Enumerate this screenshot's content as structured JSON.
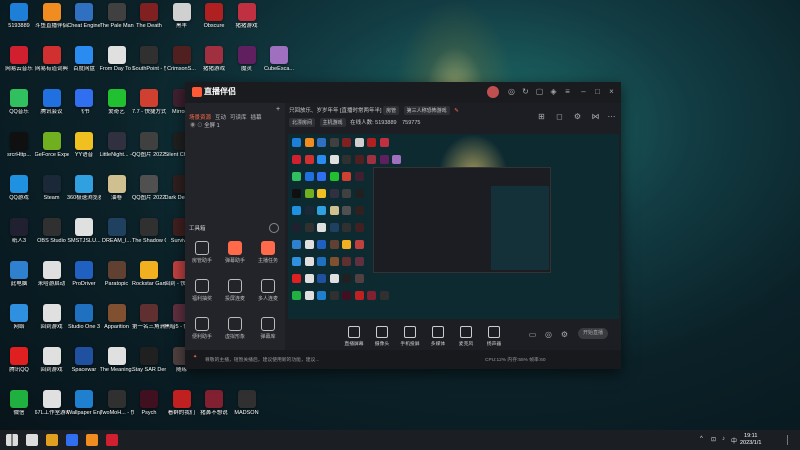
{
  "desktop": {
    "icons": [
      {
        "label": "5193889",
        "color": "#1e7fd8",
        "row": 0,
        "col": 0
      },
      {
        "label": "斗鱼直播伴侣",
        "color": "#f08c20",
        "row": 0,
        "col": 1
      },
      {
        "label": "Cheat Engine",
        "color": "#3070c0",
        "row": 0,
        "col": 2
      },
      {
        "label": "The Pale Man - 快...",
        "color": "#404040",
        "row": 0,
        "col": 3
      },
      {
        "label": "The Death",
        "color": "#802020",
        "row": 0,
        "col": 4
      },
      {
        "label": "黑羊",
        "color": "#d0d0d0",
        "row": 0,
        "col": 5
      },
      {
        "label": "Obscure",
        "color": "#b02020",
        "row": 0,
        "col": 6
      },
      {
        "label": "猪猪游戏",
        "color": "#c03040",
        "row": 0,
        "col": 7
      },
      {
        "label": "网易云音乐",
        "color": "#d02030",
        "row": 1,
        "col": 0
      },
      {
        "label": "网易有道词典",
        "color": "#d03030",
        "row": 1,
        "col": 1
      },
      {
        "label": "百度网盘",
        "color": "#2a8cf0",
        "row": 1,
        "col": 2
      },
      {
        "label": "From Day To Day",
        "color": "#e0e0e0",
        "row": 1,
        "col": 3
      },
      {
        "label": "SouthPoint - 快捷方式",
        "color": "#303030",
        "row": 1,
        "col": 4
      },
      {
        "label": "CrimsonS...",
        "color": "#502020",
        "row": 1,
        "col": 5
      },
      {
        "label": "猪猪游戏",
        "color": "#a03040",
        "row": 1,
        "col": 6
      },
      {
        "label": "魔灵",
        "color": "#602060",
        "row": 1,
        "col": 7
      },
      {
        "label": "CubeEsca...",
        "color": "#a070c0",
        "row": 1,
        "col": 8
      },
      {
        "label": "QQ音乐",
        "color": "#30c060",
        "row": 2,
        "col": 0
      },
      {
        "label": "腾讯会议",
        "color": "#2070e0",
        "row": 2,
        "col": 1
      },
      {
        "label": "飞书",
        "color": "#3070f0",
        "row": 2,
        "col": 2
      },
      {
        "label": "爱奇艺",
        "color": "#20c030",
        "row": 2,
        "col": 3
      },
      {
        "label": "7.7 - 快捷方式",
        "color": "#d04030",
        "row": 2,
        "col": 4
      },
      {
        "label": "Mirror 2",
        "color": "#402030",
        "row": 2,
        "col": 5
      },
      {
        "label": "srcrHttp...",
        "color": "#101010",
        "row": 3,
        "col": 0
      },
      {
        "label": "GeForce Experience",
        "color": "#70b020",
        "row": 3,
        "col": 1
      },
      {
        "label": "YY语音",
        "color": "#f0c020",
        "row": 3,
        "col": 2
      },
      {
        "label": "LittleNight... - 快捷方式",
        "color": "#303040",
        "row": 3,
        "col": 3
      },
      {
        "label": "QQ图片 2022123...",
        "color": "#404040",
        "row": 3,
        "col": 4
      },
      {
        "label": "Silent Channel",
        "color": "#202020",
        "row": 3,
        "col": 5
      },
      {
        "label": "QQ游戏",
        "color": "#2090e0",
        "row": 4,
        "col": 0
      },
      {
        "label": "Steam",
        "color": "#1b2838",
        "row": 4,
        "col": 1
      },
      {
        "label": "360极速浏览器",
        "color": "#30a0e0",
        "row": 4,
        "col": 2
      },
      {
        "label": "油卷",
        "color": "#d0c090",
        "row": 4,
        "col": 3
      },
      {
        "label": "QQ图片 2022123...",
        "color": "#505050",
        "row": 4,
        "col": 4
      },
      {
        "label": "Dark Deception",
        "color": "#302020",
        "row": 4,
        "col": 5
      },
      {
        "label": "纸人3",
        "color": "#202030",
        "row": 5,
        "col": 0
      },
      {
        "label": "OBS Studio",
        "color": "#303030",
        "row": 5,
        "col": 1
      },
      {
        "label": "SMSTJSLU...",
        "color": "#e0e0e0",
        "row": 5,
        "col": 2
      },
      {
        "label": "DREAM_I...",
        "color": "#204060",
        "row": 5,
        "col": 3
      },
      {
        "label": "The Shadow Over Rout...",
        "color": "#303030",
        "row": 5,
        "col": 4
      },
      {
        "label": "Survive?",
        "color": "#402020",
        "row": 5,
        "col": 5
      },
      {
        "label": "此电脑",
        "color": "#3080d0",
        "row": 6,
        "col": 0
      },
      {
        "label": "米哈游启动",
        "color": "#e0e0e0",
        "row": 6,
        "col": 1
      },
      {
        "label": "ProDriver",
        "color": "#2060c0",
        "row": 6,
        "col": 2
      },
      {
        "label": "Paratopic",
        "color": "#604030",
        "row": 6,
        "col": 3
      },
      {
        "label": "Rockstar Games...",
        "color": "#f0b020",
        "row": 6,
        "col": 4
      },
      {
        "label": "回到 - 快捷方式",
        "color": "#c04040",
        "row": 6,
        "col": 5
      },
      {
        "label": "网络",
        "color": "#3090e0",
        "row": 7,
        "col": 0
      },
      {
        "label": "回到游戏",
        "color": "#e0e0e0",
        "row": 7,
        "col": 1
      },
      {
        "label": "Studio One 3",
        "color": "#2070c0",
        "row": 7,
        "col": 2
      },
      {
        "label": "Apparition",
        "color": "#805030",
        "row": 7,
        "col": 3
      },
      {
        "label": "第一名三角洲行动",
        "color": "#603030",
        "row": 7,
        "col": 4
      },
      {
        "label": "黑暗5 - 快捷方式",
        "color": "#603040",
        "row": 7,
        "col": 5
      },
      {
        "label": "腾讯QQ",
        "color": "#e02020",
        "row": 8,
        "col": 0
      },
      {
        "label": "回到游戏",
        "color": "#e0e0e0",
        "row": 8,
        "col": 1
      },
      {
        "label": "Spacewar",
        "color": "#2050a0",
        "row": 8,
        "col": 2
      },
      {
        "label": "The Meaning...",
        "color": "#e0e0e0",
        "row": 8,
        "col": 3
      },
      {
        "label": "Stay SAR Demo",
        "color": "#202020",
        "row": 8,
        "col": 4
      },
      {
        "label": "随缘",
        "color": "#504040",
        "row": 8,
        "col": 5
      },
      {
        "label": "微信",
        "color": "#20b040",
        "row": 9,
        "col": 0
      },
      {
        "label": "67L工作室游戏",
        "color": "#e0e0e0",
        "row": 9,
        "col": 1
      },
      {
        "label": "Wallpaper Engine...",
        "color": "#2080d0",
        "row": 9,
        "col": 2
      },
      {
        "label": "TwoMoH... - 快捷方式",
        "color": "#303030",
        "row": 9,
        "col": 3
      },
      {
        "label": "Psych",
        "color": "#401020",
        "row": 9,
        "col": 4
      },
      {
        "label": "看群的我们",
        "color": "#c02020",
        "row": 9,
        "col": 5
      },
      {
        "label": "猪鼻不想说",
        "color": "#802030",
        "row": 9,
        "col": 6
      },
      {
        "label": "MADSON",
        "color": "#303030",
        "row": 9,
        "col": 7
      }
    ]
  },
  "app": {
    "title": "直播伴侣",
    "left_tabs": [
      "场景资源",
      "互动",
      "可读库",
      "插幕"
    ],
    "scene_label": "全屏 1",
    "tools_title": "工具箱",
    "tools": [
      {
        "label": "房管助手",
        "hot": false
      },
      {
        "label": "弹幕助手",
        "hot": true
      },
      {
        "label": "主播任务",
        "hot": true
      },
      {
        "label": "福利抽奖",
        "hot": false
      },
      {
        "label": "投屏连麦",
        "hot": false
      },
      {
        "label": "多人连麦",
        "hot": false
      },
      {
        "label": "便利助手",
        "hot": false
      },
      {
        "label": "虚拟形象",
        "hot": false
      },
      {
        "label": "弹幕库",
        "hot": false
      }
    ],
    "header_text": "只回放乐、岁岁年年 [直播时常两年半]",
    "header_chips": [
      "房管",
      "第三人称恐怖游戏"
    ],
    "header_chips2": [
      "北漂房间",
      "主机游戏"
    ],
    "header_stats": [
      "在线人数: 5193889",
      "759775"
    ],
    "bottom_buttons": [
      {
        "label": "直播屏幕"
      },
      {
        "label": "摄像头"
      },
      {
        "label": "手机投屏"
      },
      {
        "label": "多媒体"
      },
      {
        "label": "麦克风"
      },
      {
        "label": "扬声器"
      }
    ],
    "start_label": "开始直播",
    "notice": "尊敬的主播，短暂关播后，建议使用新的功能，建议...",
    "status_right": "CPU:12%  内存:55%  帧率:60"
  },
  "taskbar": {
    "clock_time": "19:11",
    "clock_date": "2023/1/1",
    "ime": "中",
    "pinned": [
      {
        "name": "start-menu",
        "color": "#ffffff"
      },
      {
        "name": "search",
        "color": "#dddddd"
      },
      {
        "name": "chrome",
        "color": "#e0a020"
      },
      {
        "name": "feishu",
        "color": "#3070f0"
      },
      {
        "name": "live-companion",
        "color": "#f08c20"
      },
      {
        "name": "netease-music",
        "color": "#d02030"
      }
    ]
  }
}
